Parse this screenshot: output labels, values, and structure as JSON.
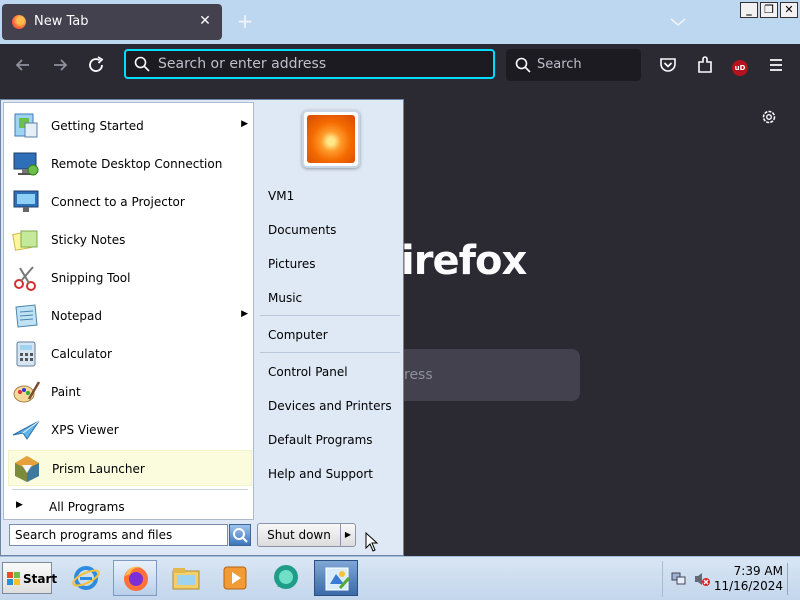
{
  "browser": {
    "tab": {
      "title": "New Tab",
      "close_glyph": "✕"
    },
    "new_tab_glyph": "+",
    "window_controls": {
      "minimize": "_",
      "restore": "❐",
      "close": "✕"
    },
    "urlbar": {
      "placeholder": "Search or enter address"
    },
    "searchbar": {
      "placeholder": "Search"
    },
    "content": {
      "brand_text": "irefox",
      "search_hint": "ress"
    },
    "icons": [
      "back-icon",
      "forward-icon",
      "reload-icon",
      "pocket-icon",
      "extensions-icon",
      "ublock-icon",
      "menu-icon",
      "gear-icon"
    ],
    "ublock_label": "uD"
  },
  "start_menu": {
    "programs": [
      {
        "label": "Getting Started",
        "icon": "getting-started-icon",
        "has_submenu": true
      },
      {
        "label": "Remote Desktop Connection",
        "icon": "remote-desktop-icon",
        "has_submenu": false
      },
      {
        "label": "Connect to a Projector",
        "icon": "projector-icon",
        "has_submenu": false
      },
      {
        "label": "Sticky Notes",
        "icon": "sticky-notes-icon",
        "has_submenu": false
      },
      {
        "label": "Snipping Tool",
        "icon": "snipping-tool-icon",
        "has_submenu": false
      },
      {
        "label": "Notepad",
        "icon": "notepad-icon",
        "has_submenu": true
      },
      {
        "label": "Calculator",
        "icon": "calculator-icon",
        "has_submenu": false
      },
      {
        "label": "Paint",
        "icon": "paint-icon",
        "has_submenu": false
      },
      {
        "label": "XPS Viewer",
        "icon": "xps-viewer-icon",
        "has_submenu": false
      },
      {
        "label": "Prism Launcher",
        "icon": "prism-launcher-icon",
        "has_submenu": false,
        "highlighted": true
      }
    ],
    "all_programs": "All Programs",
    "right_links": {
      "user": "VM1",
      "documents": "Documents",
      "pictures": "Pictures",
      "music": "Music",
      "computer": "Computer",
      "control_panel": "Control Panel",
      "devices": "Devices and Printers",
      "default_programs": "Default Programs",
      "help": "Help and Support"
    },
    "search": {
      "placeholder": "Search programs and files"
    },
    "shutdown_label": "Shut down",
    "arrow_glyph": "▶"
  },
  "taskbar": {
    "start_label": "Start",
    "apps": [
      "internet-explorer-icon",
      "firefox-icon",
      "file-explorer-icon",
      "media-player-icon",
      "chat-app-icon",
      "active-app-icon"
    ],
    "clock": {
      "time": "7:39 AM",
      "date": "11/16/2024"
    }
  },
  "colors": {
    "accent": "#00ddff",
    "browser_bg": "#2b2a33",
    "taskbar": "#c3d6ec"
  }
}
